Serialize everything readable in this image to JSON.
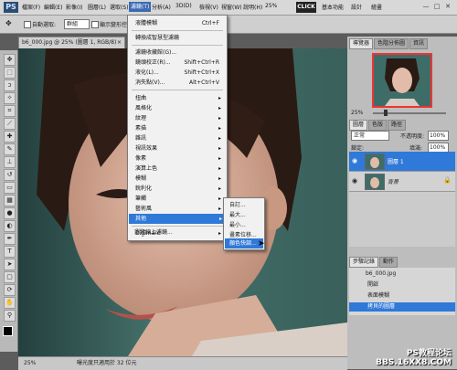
{
  "app": {
    "logo": "PS"
  },
  "menubar": {
    "items": [
      "檔案(F)",
      "編輯(E)",
      "影像(I)",
      "圖層(L)",
      "選取(S)",
      "濾鏡(T)",
      "分析(A)",
      "3D(D)",
      "檢視(V)",
      "視窗(W)",
      "說明(H)"
    ],
    "zoom": "25%",
    "click_label": "CLICK",
    "workspaces": [
      "基本功能",
      "設計",
      "繪畫"
    ],
    "window_controls": [
      "—",
      "□",
      "✕"
    ]
  },
  "options": {
    "auto_select_label": "自動選取:",
    "auto_select_value": "群組",
    "show_transform_label": "顯示變形控制項"
  },
  "document": {
    "tab_title": "b6_000.jpg @ 25% (圖層 1, RGB/8)",
    "status_zoom": "25%",
    "status_text": "曝光度只適用於 32 位元"
  },
  "filter_menu": {
    "items": [
      {
        "label": "液體模糊",
        "shortcut": "Ctrl+F"
      },
      {
        "label": "轉換成智慧型濾鏡",
        "shortcut": ""
      },
      {
        "label": "濾鏡收藏館(G)...",
        "shortcut": ""
      },
      {
        "label": "鏡頭校正(R)...",
        "shortcut": "Shift+Ctrl+R"
      },
      {
        "label": "液化(L)...",
        "shortcut": "Shift+Ctrl+X"
      },
      {
        "label": "消失點(V)...",
        "shortcut": "Alt+Ctrl+V"
      },
      {
        "label": "扭曲",
        "submenu": true
      },
      {
        "label": "風格化",
        "submenu": true
      },
      {
        "label": "紋理",
        "submenu": true
      },
      {
        "label": "素描",
        "submenu": true
      },
      {
        "label": "雜訊",
        "submenu": true
      },
      {
        "label": "視訊效果",
        "submenu": true
      },
      {
        "label": "像素",
        "submenu": true
      },
      {
        "label": "演算上色",
        "submenu": true
      },
      {
        "label": "模糊",
        "submenu": true
      },
      {
        "label": "銳利化",
        "submenu": true
      },
      {
        "label": "筆觸",
        "submenu": true
      },
      {
        "label": "藝術風",
        "submenu": true
      },
      {
        "label": "其他",
        "submenu": true
      },
      {
        "label": "Digimarc",
        "submenu": true
      },
      {
        "label": "瀏覽線上濾鏡...",
        "shortcut": ""
      }
    ]
  },
  "other_submenu": {
    "items": [
      "自訂...",
      "最大...",
      "最小...",
      "畫素位移...",
      "顏色快調..."
    ]
  },
  "panels": {
    "nav_tabs": [
      "導覽器",
      "色階分佈圖",
      "資訊"
    ],
    "nav_zoom": "25%",
    "layers_tabs": [
      "圖層",
      "色版",
      "路徑"
    ],
    "blend_mode": "正常",
    "opacity_label": "不透明度:",
    "opacity_value": "100%",
    "lock_label": "鎖定:",
    "fill_label": "填滿:",
    "fill_value": "100%",
    "layers": [
      {
        "name": "圖層 1",
        "selected": true
      },
      {
        "name": "背景",
        "selected": false
      }
    ],
    "history_tabs": [
      "步驟記錄",
      "動作"
    ],
    "history_file": "b6_000.jpg",
    "history_items": [
      "開啟",
      "表面模糊",
      "拷貝的圖層"
    ]
  },
  "watermark": {
    "line1": "PS教程论坛",
    "line2": "BBS.16XX8.COM"
  },
  "colors": {
    "menu_highlight": "#2f79d8",
    "thumb_border": "#e33333"
  }
}
